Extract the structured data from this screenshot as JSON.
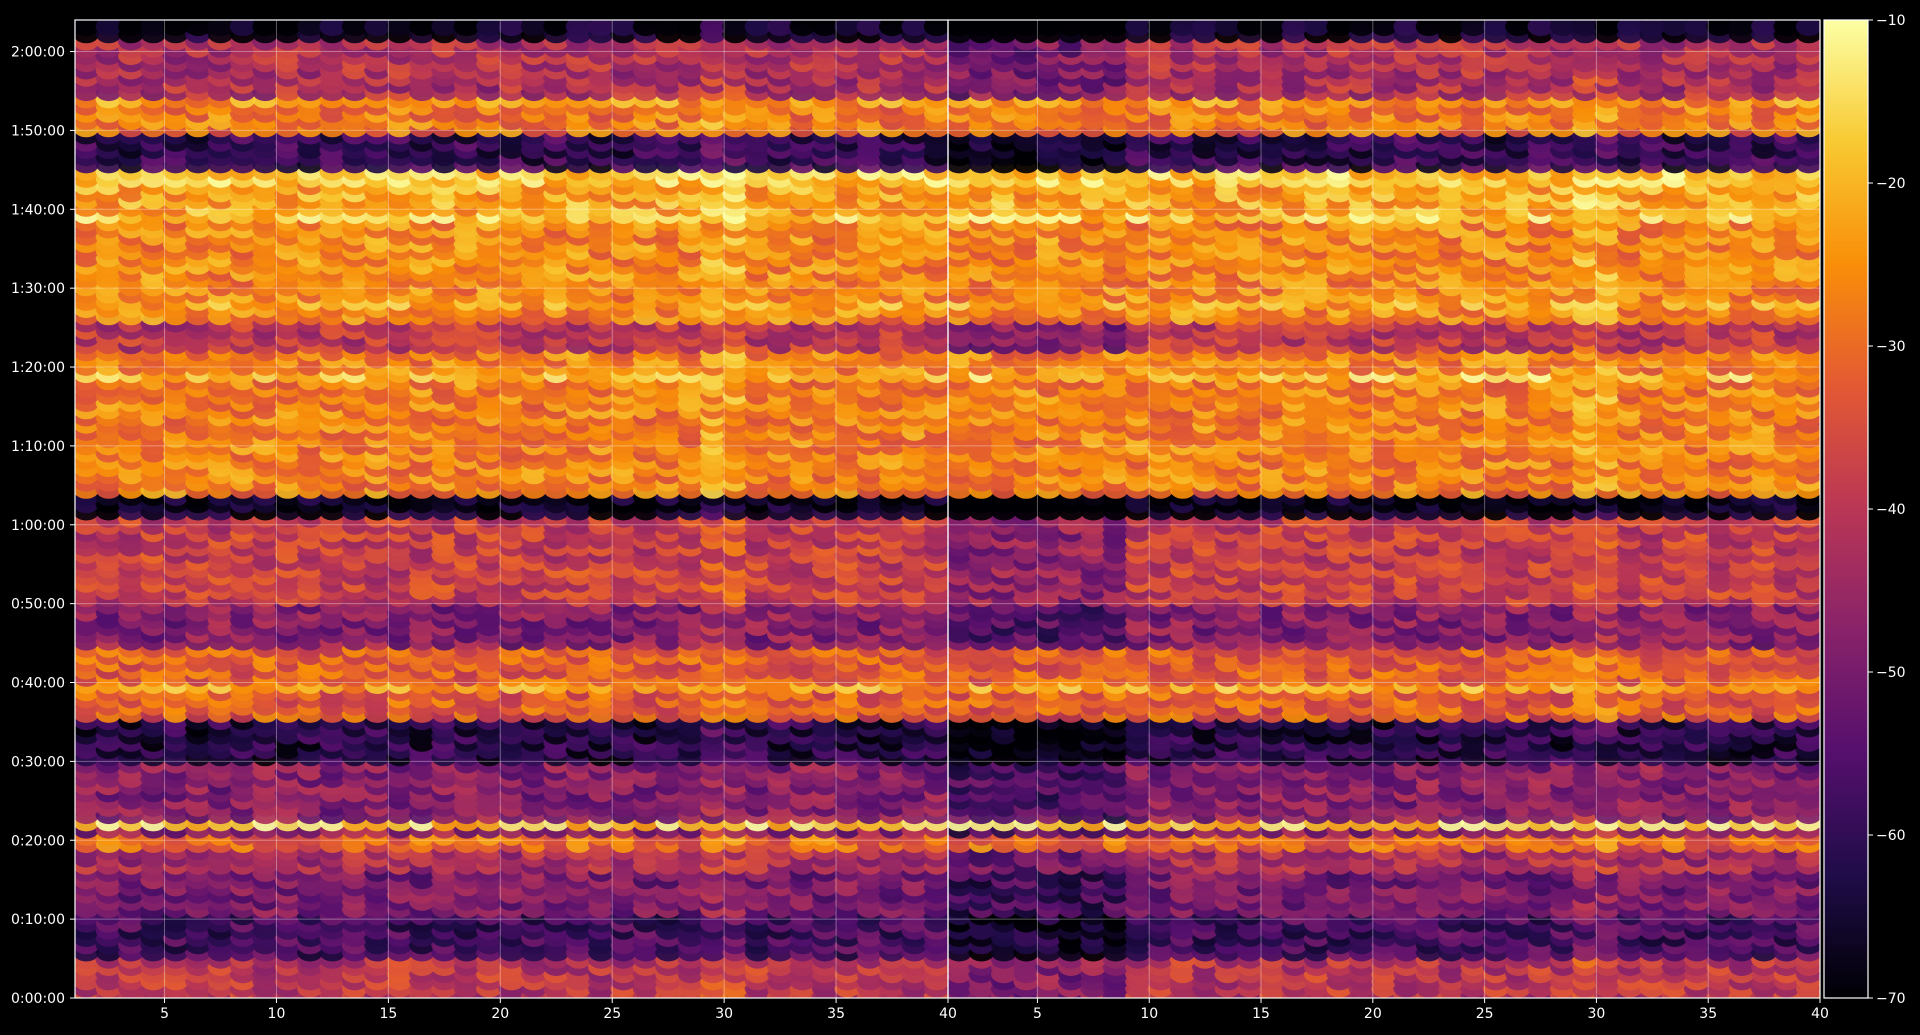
{
  "chart_data": {
    "type": "heatmap",
    "title": "",
    "xlabel": "",
    "ylabel": "",
    "colormap": "inferno",
    "grid": true,
    "panels": [
      {
        "name": "",
        "xlim": [
          1,
          40
        ],
        "xticks": [
          5,
          10,
          15,
          20,
          25,
          30,
          35,
          40
        ],
        "xticklabels": [
          "5",
          "10",
          "15",
          "20",
          "25",
          "30",
          "35",
          "40"
        ]
      },
      {
        "name": "",
        "xlim": [
          1,
          40
        ],
        "xticks": [
          5,
          10,
          15,
          20,
          25,
          30,
          35,
          40
        ],
        "xticklabels": [
          "5",
          "10",
          "15",
          "20",
          "25",
          "30",
          "35",
          "40"
        ]
      }
    ],
    "y_axis": {
      "lim_seconds": [
        0,
        7440
      ],
      "ticks_seconds": [
        0,
        600,
        1200,
        1800,
        2400,
        3000,
        3600,
        4200,
        4800,
        5400,
        6000,
        6600,
        7200
      ],
      "ticklabels": [
        "0:00:00",
        "0:10:00",
        "0:20:00",
        "0:30:00",
        "0:40:00",
        "0:50:00",
        "1:00:00",
        "1:10:00",
        "1:20:00",
        "1:30:00",
        "1:40:00",
        "1:50:00",
        "2:00:00"
      ]
    },
    "colorbar": {
      "range": [
        -70,
        -10
      ],
      "ticks": [
        -70,
        -60,
        -50,
        -40,
        -30,
        -20,
        -10
      ],
      "ticklabels": [
        "−70",
        "−60",
        "−50",
        "−40",
        "−30",
        "−20",
        "−10"
      ]
    },
    "bands": [
      {
        "from": 0,
        "to": 350,
        "value": -40
      },
      {
        "from": 350,
        "to": 650,
        "value": -57
      },
      {
        "from": 650,
        "to": 960,
        "value": -50
      },
      {
        "from": 960,
        "to": 1130,
        "value": -43
      },
      {
        "from": 1130,
        "to": 1240,
        "value": -30
      },
      {
        "from": 1240,
        "to": 1790,
        "value": -48
      },
      {
        "from": 1790,
        "to": 2150,
        "value": -62
      },
      {
        "from": 2150,
        "to": 2680,
        "value": -32
      },
      {
        "from": 2680,
        "to": 3000,
        "value": -48
      },
      {
        "from": 3000,
        "to": 3680,
        "value": -38
      },
      {
        "from": 3680,
        "to": 3870,
        "value": -68
      },
      {
        "from": 3870,
        "to": 4950,
        "value": -27
      },
      {
        "from": 4950,
        "to": 5150,
        "value": -40
      },
      {
        "from": 5150,
        "to": 5950,
        "value": -26
      },
      {
        "from": 5950,
        "to": 6340,
        "value": -22
      },
      {
        "from": 6340,
        "to": 6620,
        "value": -60
      },
      {
        "from": 6620,
        "to": 6830,
        "value": -28
      },
      {
        "from": 6830,
        "to": 7330,
        "value": -42
      }
    ],
    "hot_rows": [
      {
        "t": 1320,
        "value": -16
      },
      {
        "t": 2400,
        "value": -22
      },
      {
        "t": 4750,
        "value": -18
      },
      {
        "t": 5300,
        "value": -22
      },
      {
        "t": 5960,
        "value": -17
      },
      {
        "t": 6260,
        "value": -17
      },
      {
        "t": 6840,
        "value": -24
      }
    ]
  }
}
